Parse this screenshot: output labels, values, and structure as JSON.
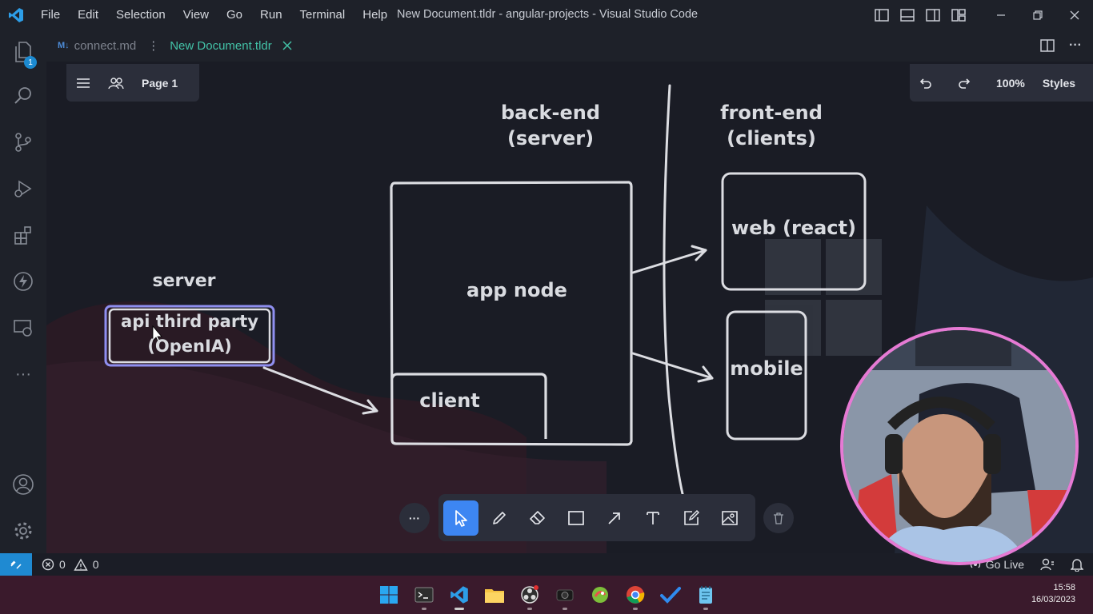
{
  "titlebar": {
    "menu": [
      "File",
      "Edit",
      "Selection",
      "View",
      "Go",
      "Run",
      "Terminal",
      "Help"
    ],
    "title": "New Document.tldr - angular-projects - Visual Studio Code"
  },
  "activity": {
    "explorer_badge": "1"
  },
  "tabs": [
    {
      "label": "connect.md",
      "active": false
    },
    {
      "label": "New Document.tldr",
      "active": true
    }
  ],
  "tldraw": {
    "page_label": "Page 1",
    "zoom": "100%",
    "styles_label": "Styles"
  },
  "diagram": {
    "backend_line1": "back-end",
    "backend_line2": "(server)",
    "frontend_line1": "front-end",
    "frontend_line2": "(clients)",
    "server_label": "server",
    "api_line1": "api third party",
    "api_line2": "(OpenIA)",
    "app_node": "app node",
    "client": "client",
    "web": "web (react)",
    "mobile": "mobile"
  },
  "status": {
    "errors": "0",
    "warnings": "0",
    "go_live": "Go Live"
  },
  "taskbar": {
    "time": "15:58",
    "date": "16/03/2023"
  },
  "colors": {
    "accent": "#3d86f2",
    "tab_active": "#43c3a8",
    "webcam_border": "#e67ad4",
    "taskbar": "#3a1a2c"
  }
}
